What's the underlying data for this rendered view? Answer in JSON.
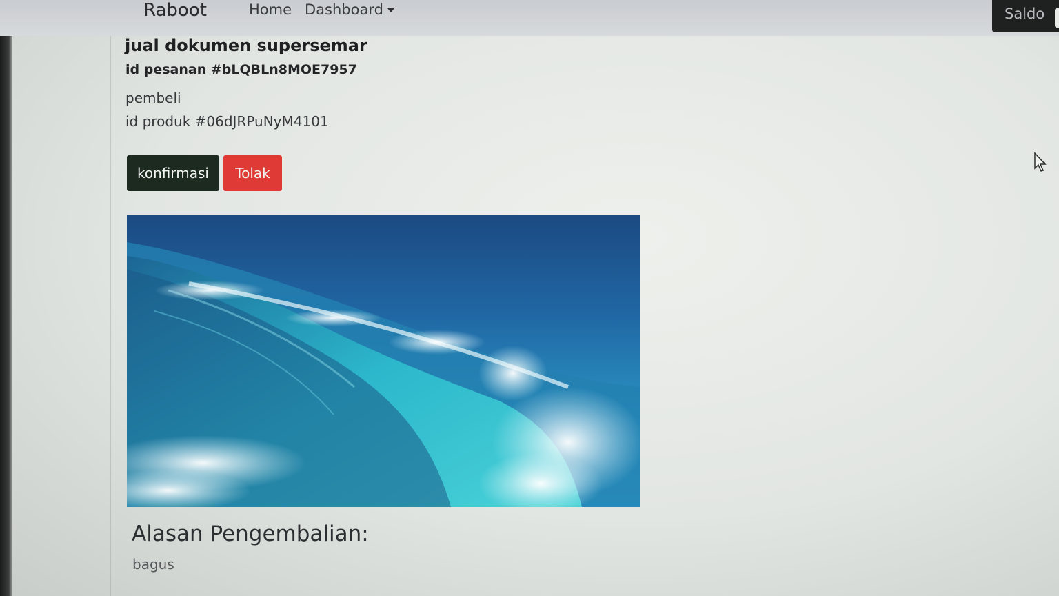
{
  "navbar": {
    "brand": "Raboot",
    "links": {
      "home": "Home",
      "dashboard": "Dashboard"
    },
    "saldo_label": "Saldo"
  },
  "order": {
    "title": "jual dokumen supersemar",
    "order_id": "id pesanan #bLQBLn8MOE7957",
    "buyer_label": "pembeli",
    "product_id": "id produk #06dJRPuNyM4101"
  },
  "actions": {
    "confirm_label": "konfirmasi",
    "reject_label": "Tolak"
  },
  "image": {
    "subject": "ocean wave"
  },
  "return_reason": {
    "heading": "Alasan Pengembalian:",
    "text": "bagus"
  },
  "colors": {
    "confirm_button": "#1c2a20",
    "reject_button": "#df3a36",
    "saldo_button": "#1f2120"
  }
}
